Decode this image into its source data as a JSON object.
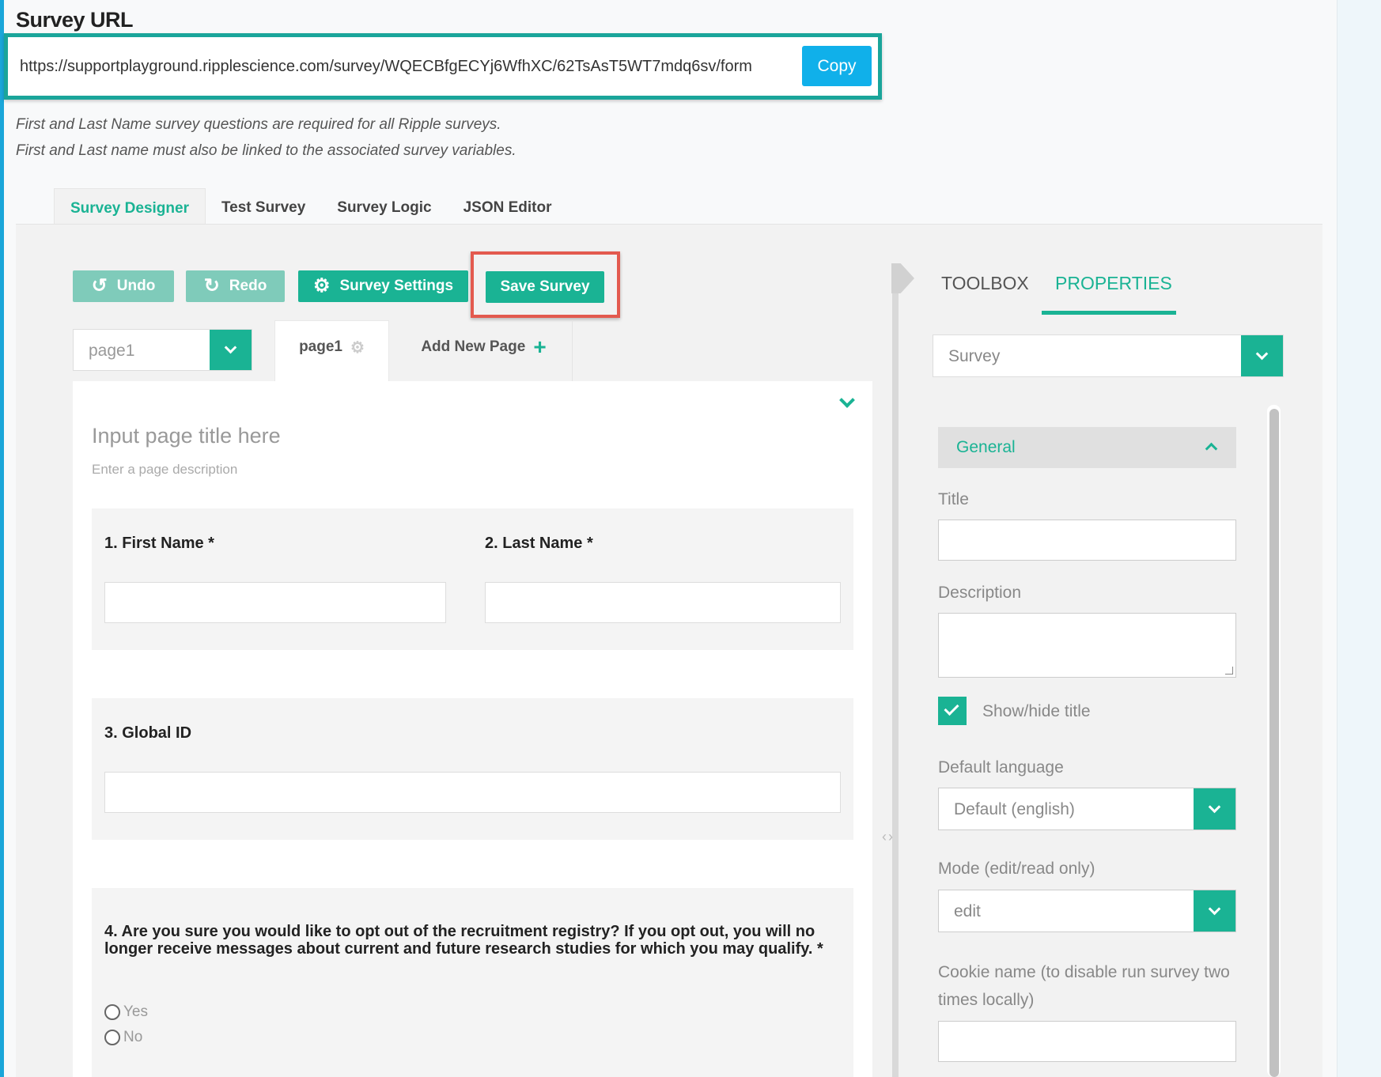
{
  "header": {
    "title": "Survey URL",
    "url": "https://supportplayground.ripplescience.com/survey/WQECBfgECYj6WfhXC/62TsAsT5WT7mdq6sv/form",
    "copy_label": "Copy"
  },
  "notes": [
    "First and Last Name survey questions are required for all Ripple surveys.",
    "First and Last name must also be linked to the associated survey variables."
  ],
  "tabs": [
    {
      "label": "Survey Designer",
      "active": true
    },
    {
      "label": "Test Survey",
      "active": false
    },
    {
      "label": "Survey Logic",
      "active": false
    },
    {
      "label": "JSON Editor",
      "active": false
    }
  ],
  "toolbar": {
    "undo_label": "Undo",
    "redo_label": "Redo",
    "settings_label": "Survey Settings",
    "save_label": "Save Survey"
  },
  "pages": {
    "selected": "page1",
    "tab_label": "page1",
    "add_label": "Add New Page"
  },
  "page": {
    "title_placeholder": "Input page title here",
    "description_placeholder": "Enter a page description"
  },
  "questions": {
    "q1": "1. First Name *",
    "q2": "2. Last Name *",
    "q3": "3. Global ID",
    "q4": "4. Are you sure you would like to opt out of the recruitment registry? If you opt out, you will no longer receive messages about current and future research studies for which you may qualify. *",
    "q4_options": [
      "Yes",
      "No"
    ]
  },
  "sidebar": {
    "toolbox_tab": "TOOLBOX",
    "properties_tab": "PROPERTIES",
    "object_selected": "Survey",
    "section_general": "General",
    "title_label": "Title",
    "description_label": "Description",
    "show_title_label": "Show/hide title",
    "show_title_checked": true,
    "default_language_label": "Default language",
    "default_language_value": "Default (english)",
    "mode_label": "Mode (edit/read only)",
    "mode_value": "edit",
    "cookie_label": "Cookie name (to disable run survey two times locally)"
  },
  "colors": {
    "accent": "#1ab394",
    "copy_button": "#10b0ea",
    "url_highlight": "#1aa59a",
    "save_highlight": "#e35a4f"
  }
}
